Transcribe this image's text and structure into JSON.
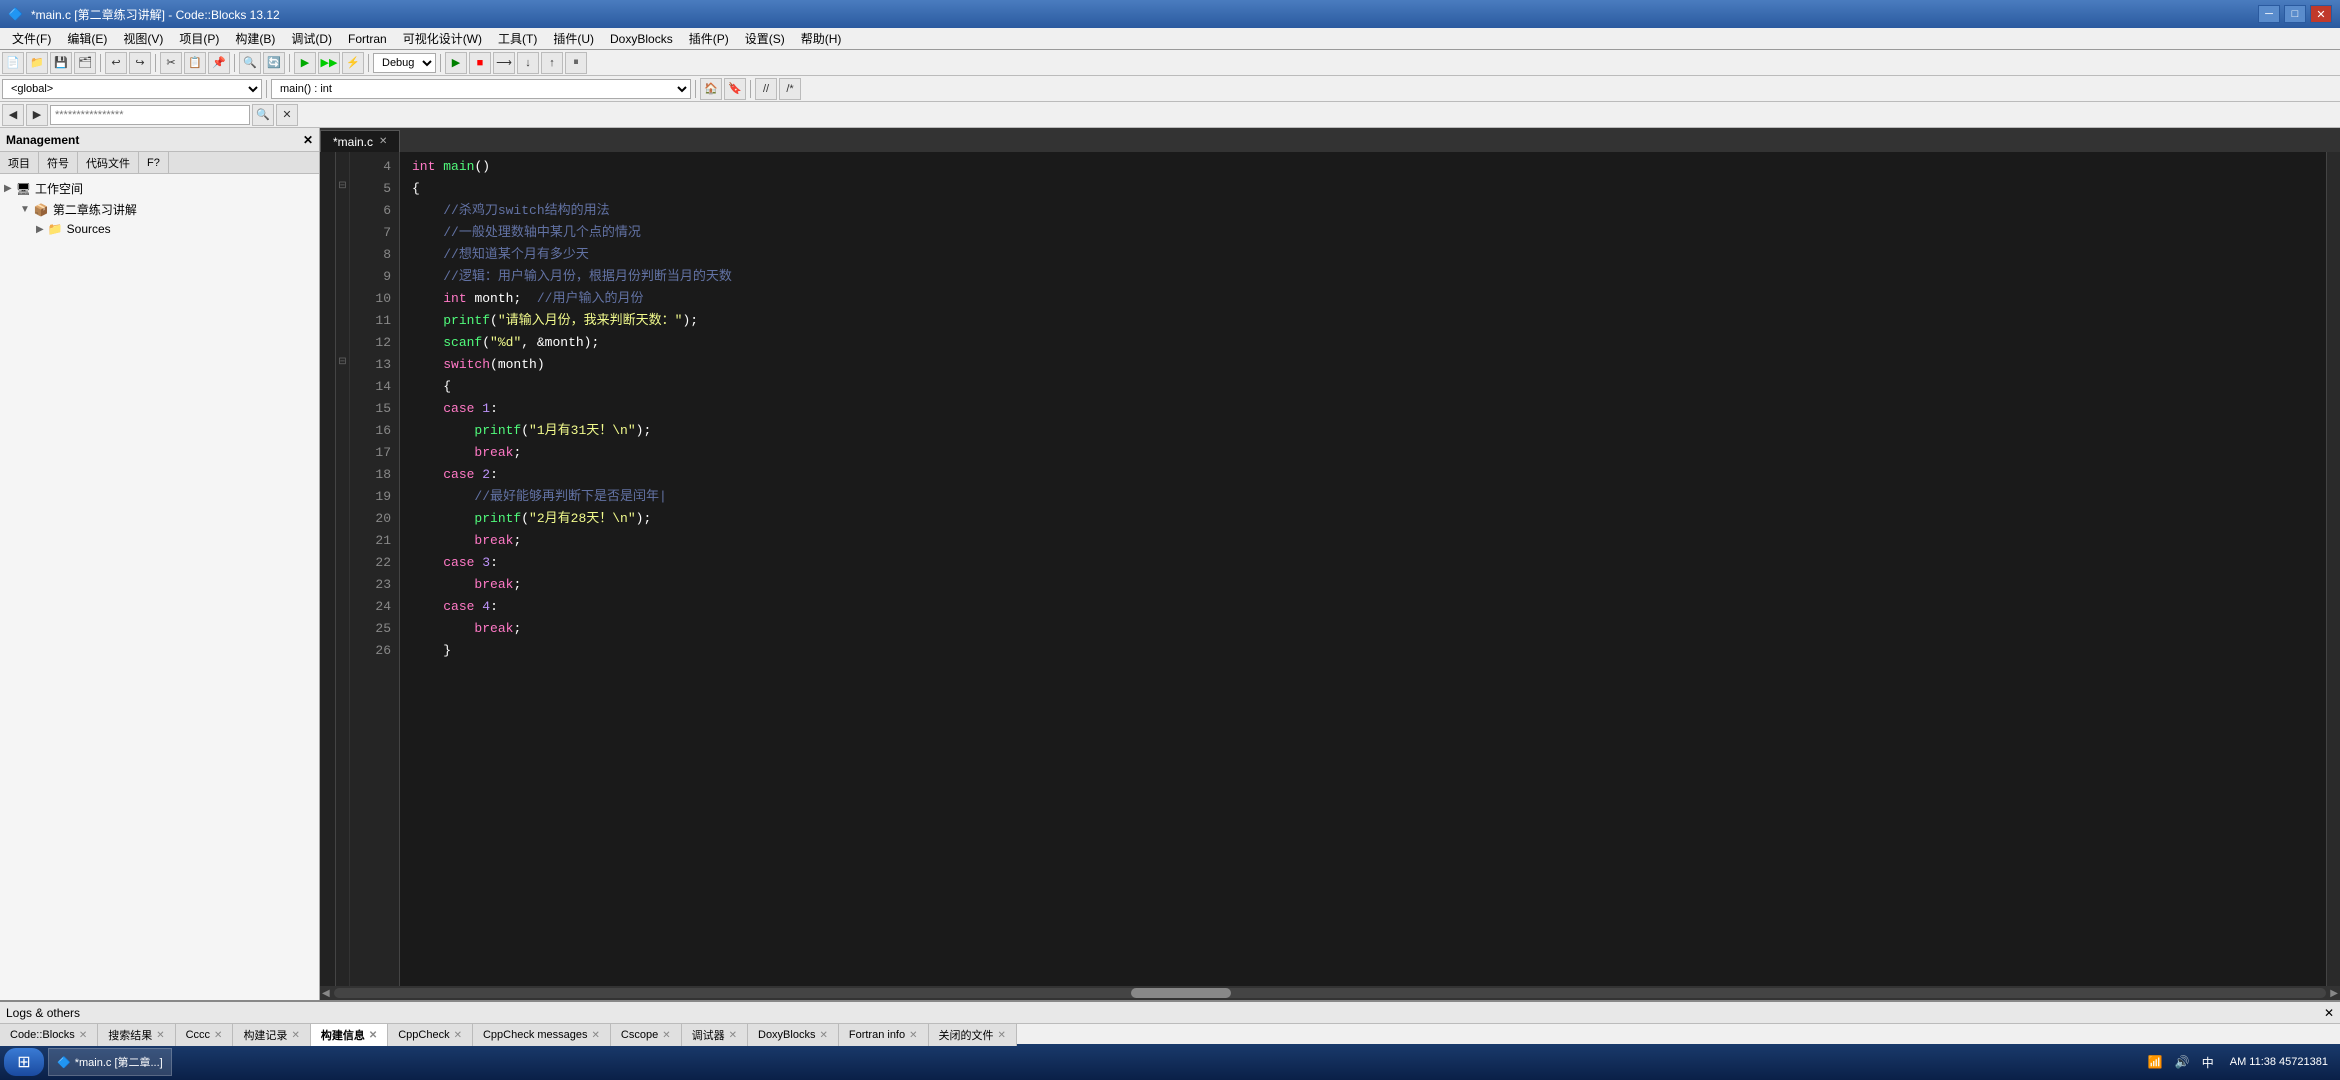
{
  "titleBar": {
    "title": "*main.c [第二章练习讲解] - Code::Blocks 13.12",
    "minBtn": "─",
    "maxBtn": "□",
    "closeBtn": "✕"
  },
  "menuBar": {
    "items": [
      "文件(F)",
      "编辑(E)",
      "视图(V)",
      "项目(P)",
      "构建(B)",
      "调试(D)",
      "Fortran",
      "可视化设计(W)",
      "工具(T)",
      "插件(U)",
      "DoxyBlocks",
      "插件(P)",
      "设置(S)",
      "帮助(H)"
    ]
  },
  "toolbars": {
    "debug_dropdown": "Debug",
    "global_dropdown": "<global>",
    "func_dropdown": "main() : int",
    "search_placeholder": "****************"
  },
  "management": {
    "header": "Management",
    "tabs": [
      "项目",
      "符号",
      "代码文件",
      "F?"
    ],
    "tree": {
      "workspace": "工作空间",
      "project": "第二章练习讲解",
      "sources": "Sources"
    }
  },
  "editor": {
    "activeTab": "*main.c",
    "lines": [
      {
        "num": 4,
        "content": "int main()"
      },
      {
        "num": 5,
        "content": "{"
      },
      {
        "num": 6,
        "content": "    //杀鸡刀switch结构的用法"
      },
      {
        "num": 7,
        "content": "    //一般处理数轴中某几个点的情况"
      },
      {
        "num": 8,
        "content": "    //想知道某个月有多少天"
      },
      {
        "num": 9,
        "content": "    //逻辑：用户输入月份，根据月份判断当月的天数"
      },
      {
        "num": 10,
        "content": "    int month;  //用户输入的月份"
      },
      {
        "num": 11,
        "content": "    printf(\"请输入月份，我来判断天数：\");"
      },
      {
        "num": 12,
        "content": "    scanf(\"%d\", &month);"
      },
      {
        "num": 13,
        "content": "    switch(month)"
      },
      {
        "num": 14,
        "content": "    {"
      },
      {
        "num": 15,
        "content": "    case 1:"
      },
      {
        "num": 16,
        "content": "        printf(\"1月有31天！\\n\");"
      },
      {
        "num": 17,
        "content": "        break;"
      },
      {
        "num": 18,
        "content": "    case 2:"
      },
      {
        "num": 19,
        "content": "        //最好能够再判断下是否是闰年|"
      },
      {
        "num": 20,
        "content": "        printf(\"2月有28天！\\n\");"
      },
      {
        "num": 21,
        "content": "        break;"
      },
      {
        "num": 22,
        "content": "    case 3:"
      },
      {
        "num": 23,
        "content": "        break;"
      },
      {
        "num": 24,
        "content": "    case 4:"
      },
      {
        "num": 25,
        "content": "        break;"
      },
      {
        "num": 26,
        "content": "    }"
      }
    ]
  },
  "logPanel": {
    "header": "Logs & others",
    "tabs": [
      {
        "label": "Code::Blocks",
        "active": false
      },
      {
        "label": "搜索结果",
        "active": false
      },
      {
        "label": "Cccc",
        "active": false
      },
      {
        "label": "构建记录",
        "active": false
      },
      {
        "label": "构建信息",
        "active": true
      },
      {
        "label": "CppCheck",
        "active": false
      },
      {
        "label": "CppCheck messages",
        "active": false
      },
      {
        "label": "Cscope",
        "active": false
      },
      {
        "label": "调试器",
        "active": false
      },
      {
        "label": "DoxyBlocks",
        "active": false
      },
      {
        "label": "Fortran info",
        "active": false
      },
      {
        "label": "关闭的文件",
        "active": false
      }
    ]
  },
  "taskbar": {
    "items": [],
    "clock": "AM 11:38\n45721381"
  }
}
